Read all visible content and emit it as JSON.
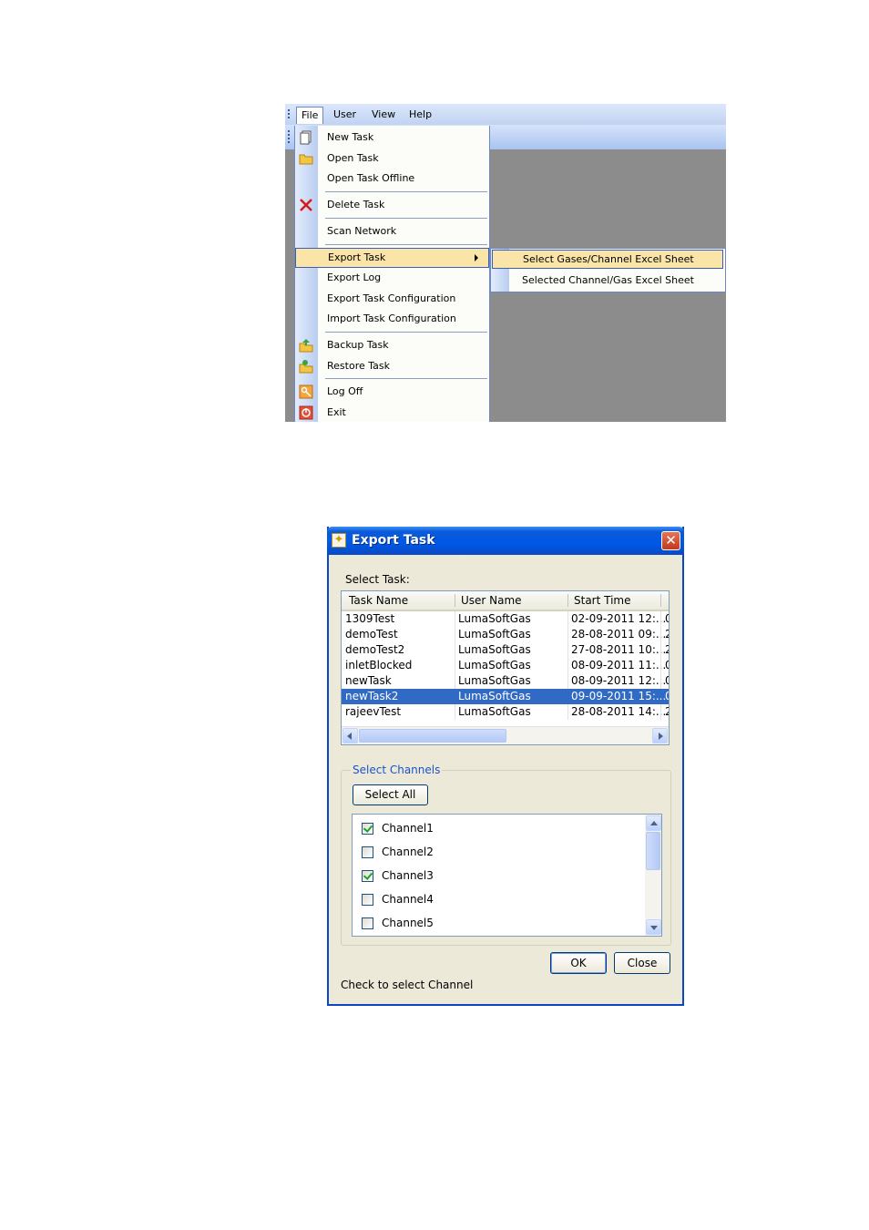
{
  "menu_screenshot": {
    "menubar": [
      "File",
      "User",
      "View",
      "Help"
    ],
    "file_menu": [
      {
        "label": "New Task",
        "icon": "new-document-icon"
      },
      {
        "label": "Open Task",
        "icon": "open-folder-icon"
      },
      {
        "label": "Open Task Offline",
        "icon": ""
      },
      {
        "label": "Delete Task",
        "icon": "delete-x-icon"
      },
      {
        "label": "Scan Network",
        "icon": ""
      },
      {
        "label": "Export Task",
        "icon": "",
        "highlighted": true,
        "has_submenu": true
      },
      {
        "label": "Export Log",
        "icon": ""
      },
      {
        "label": "Export Task Configuration",
        "icon": ""
      },
      {
        "label": "Import Task Configuration",
        "icon": ""
      },
      {
        "label": "Backup Task",
        "icon": "backup-folder-icon"
      },
      {
        "label": "Restore Task",
        "icon": "restore-folder-icon"
      },
      {
        "label": "Log Off",
        "icon": "key-icon"
      },
      {
        "label": "Exit",
        "icon": "power-icon"
      }
    ],
    "submenu": [
      {
        "label": "Select Gases/Channel Excel Sheet",
        "highlighted": true
      },
      {
        "label": "Selected Channel/Gas Excel Sheet"
      }
    ]
  },
  "dialog": {
    "title": "Export Task",
    "select_task_label": "Select Task:",
    "columns": [
      "Task Name",
      "User Name",
      "Start Time"
    ],
    "rows": [
      {
        "task": "1309Test",
        "user": "LumaSoftGas",
        "start": "02-09-2011 12:...",
        "extra": "0"
      },
      {
        "task": "demoTest",
        "user": "LumaSoftGas",
        "start": "28-08-2011 09:...",
        "extra": "2"
      },
      {
        "task": "demoTest2",
        "user": "LumaSoftGas",
        "start": "27-08-2011 10:...",
        "extra": "2"
      },
      {
        "task": "inletBlocked",
        "user": "LumaSoftGas",
        "start": "08-09-2011 11:...",
        "extra": "0"
      },
      {
        "task": "newTask",
        "user": "LumaSoftGas",
        "start": "08-09-2011 12:...",
        "extra": "0"
      },
      {
        "task": "newTask2",
        "user": "LumaSoftGas",
        "start": "09-09-2011 15:...",
        "extra": "0",
        "selected": true
      },
      {
        "task": "rajeevTest",
        "user": "LumaSoftGas",
        "start": "28-08-2011 14:...",
        "extra": "2"
      }
    ],
    "select_channels_label": "Select Channels",
    "select_all_label": "Select All",
    "channels": [
      {
        "name": "Channel1",
        "checked": true
      },
      {
        "name": "Channel2",
        "checked": false
      },
      {
        "name": "Channel3",
        "checked": true
      },
      {
        "name": "Channel4",
        "checked": false
      },
      {
        "name": "Channel5",
        "checked": false
      }
    ],
    "ok_label": "OK",
    "close_label": "Close",
    "status_text": "Check to select Channel",
    "colors": {
      "title_bar": "#0058e6",
      "selection": "#316ac5",
      "menu_highlight": "#fbe4a8",
      "group_legend": "#1c52c8"
    }
  }
}
